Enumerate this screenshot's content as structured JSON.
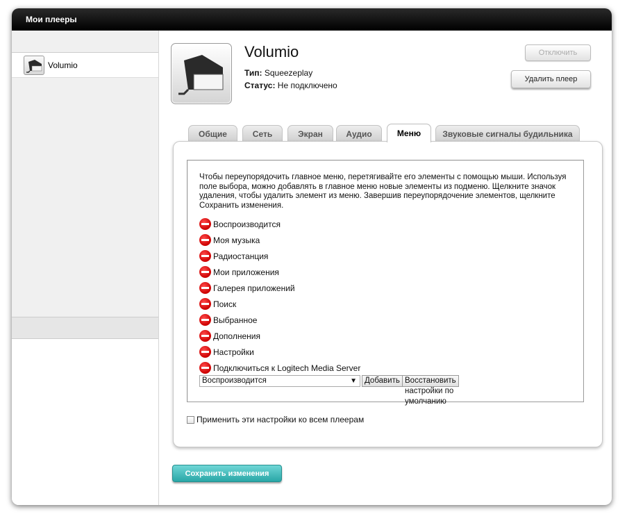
{
  "window": {
    "title": "Мои плееры"
  },
  "sidebar": {
    "items": [
      {
        "label": "Volumio",
        "icon": "player-device-icon"
      }
    ]
  },
  "player": {
    "name": "Volumio",
    "type_label": "Тип:",
    "type_value": "Squeezeplay",
    "status_label": "Статус:",
    "status_value": "Не подключено"
  },
  "actions": {
    "disconnect_label": "Отключить",
    "delete_label": "Удалить плеер"
  },
  "tabs": [
    {
      "label": "Общие",
      "active": false
    },
    {
      "label": "Сеть",
      "active": false
    },
    {
      "label": "Экран",
      "active": false
    },
    {
      "label": "Аудио",
      "active": false
    },
    {
      "label": "Меню",
      "active": true
    },
    {
      "label": "Звуковые сигналы будильника",
      "active": false
    }
  ],
  "menu_panel": {
    "instructions": "Чтобы переупорядочить главное меню, перетягивайте его элементы с помощью мыши. Используя поле выбора, можно добавлять в главное меню новые элементы из подменю. Щелкните значок удаления, чтобы удалить элемент из меню. Завершив переупорядочение элементов, щелкните Сохранить изменения.",
    "items": [
      "Воспроизводится",
      "Моя музыка",
      "Радиостанция",
      "Мои приложения",
      "Галерея приложений",
      "Поиск",
      "Выбранное",
      "Дополнения",
      "Настройки",
      "Подключиться к Logitech Media Server"
    ],
    "select_value": "Воспроизводится",
    "add_label": "Добавить",
    "restore_label": "Восстановить настройки по умолчанию"
  },
  "apply_all": {
    "label": "Применить эти настройки ко всем плеерам",
    "checked": false
  },
  "save_label": "Сохранить изменения",
  "colors": {
    "accent": "#2eb0b0",
    "delete_icon": "#dd0000",
    "titlebar": "#000000"
  }
}
